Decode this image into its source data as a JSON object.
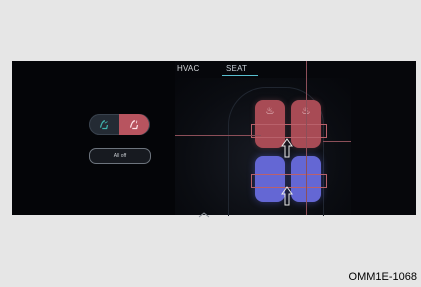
{
  "tabs": {
    "hvac_label": "HVAC",
    "seat_label": "SEAT"
  },
  "controls": {
    "all_off_label": "All off",
    "left_icon": "ventilated-seat-icon",
    "right_icon": "heated-seat-icon"
  },
  "colors": {
    "screen": "#06070b",
    "rear_seat": "#a84b55",
    "front_seat": "#6467d4",
    "accent": "#58bfd0"
  },
  "caption": "OMM1E-1068"
}
